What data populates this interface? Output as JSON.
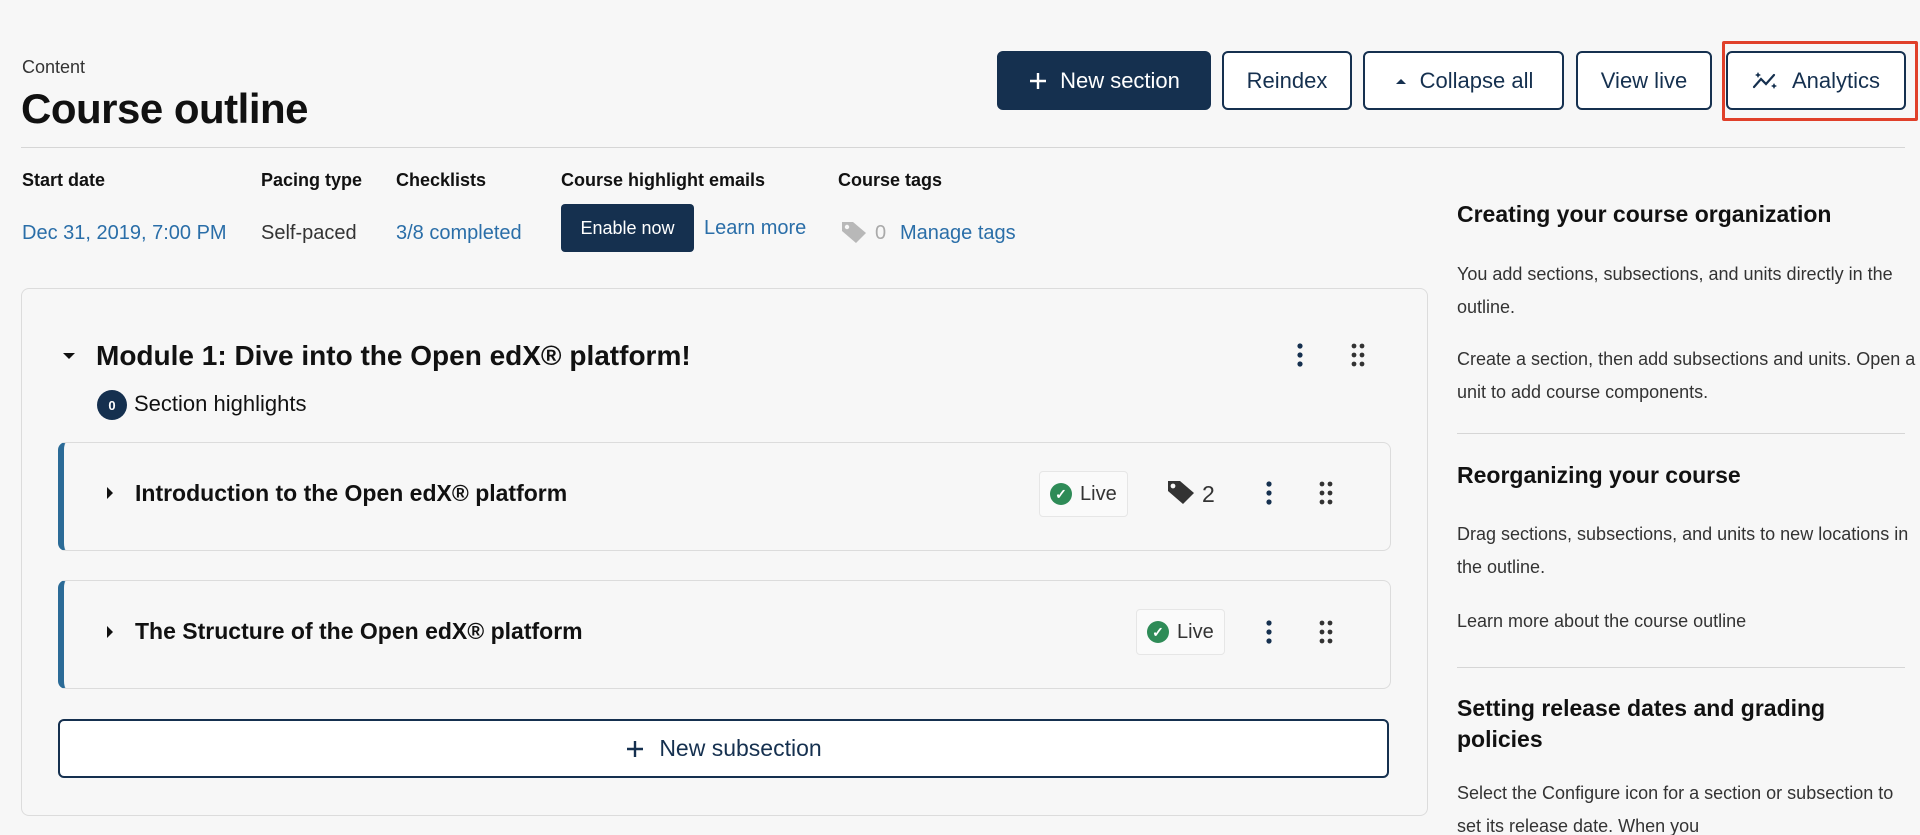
{
  "header": {
    "eyebrow": "Content",
    "title": "Course outline",
    "buttons": {
      "new_section": "New section",
      "reindex": "Reindex",
      "collapse_all": "Collapse all",
      "view_live": "View live",
      "analytics": "Analytics"
    }
  },
  "info": {
    "start_date_label": "Start date",
    "start_date_value": "Dec 31, 2019, 7:00 PM",
    "pacing_label": "Pacing type",
    "pacing_value": "Self-paced",
    "checklists_label": "Checklists",
    "checklists_value": "3/8 completed",
    "highlight_label": "Course highlight emails",
    "enable_now": "Enable now",
    "learn_more": "Learn more",
    "tags_label": "Course tags",
    "tags_count": "0",
    "manage_tags": "Manage tags"
  },
  "section": {
    "title": "Module 1: Dive into the Open edX® platform!",
    "highlights_count": "0",
    "highlights_label": "Section highlights",
    "subsections": [
      {
        "title": "Introduction to the Open edX® platform",
        "status": "Live",
        "tag_count": "2"
      },
      {
        "title": "The Structure of the Open edX® platform",
        "status": "Live"
      }
    ],
    "new_subsection": "New subsection"
  },
  "sidebar": {
    "h1": "Creating your course organization",
    "p1": "You add sections, subsections, and units directly in the outline.",
    "p2": "Create a section, then add subsections and units. Open a unit to add course components.",
    "h2": "Reorganizing your course",
    "p3": "Drag sections, subsections, and units to new locations in the outline.",
    "link": "Learn more about the course outline",
    "h3": "Setting release dates and grading policies",
    "p4": "Select the Configure icon for a section or subsection to set its release date. When you"
  },
  "colors": {
    "primary": "#15304f",
    "link": "#2a6ea8",
    "live": "#2e8b57",
    "accent_bar": "#2b6b97",
    "highlight": "#e0402a"
  }
}
